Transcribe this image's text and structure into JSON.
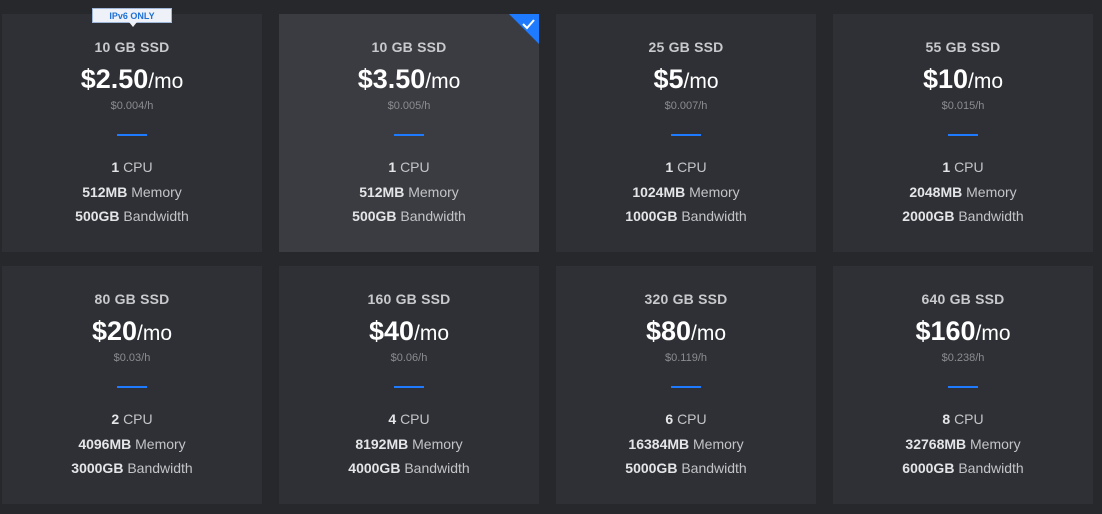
{
  "plans": [
    {
      "storage": "10 GB SSD",
      "price": "$2.50",
      "unit": "/mo",
      "hourly": "$0.004/h",
      "cpu": "1",
      "cpu_label": "CPU",
      "memory": "512MB",
      "memory_label": "Memory",
      "bandwidth": "500GB",
      "bandwidth_label": "Bandwidth",
      "badge": "IPv6 ONLY",
      "selected": false
    },
    {
      "storage": "10 GB SSD",
      "price": "$3.50",
      "unit": "/mo",
      "hourly": "$0.005/h",
      "cpu": "1",
      "cpu_label": "CPU",
      "memory": "512MB",
      "memory_label": "Memory",
      "bandwidth": "500GB",
      "bandwidth_label": "Bandwidth",
      "badge": "",
      "selected": true
    },
    {
      "storage": "25 GB SSD",
      "price": "$5",
      "unit": "/mo",
      "hourly": "$0.007/h",
      "cpu": "1",
      "cpu_label": "CPU",
      "memory": "1024MB",
      "memory_label": "Memory",
      "bandwidth": "1000GB",
      "bandwidth_label": "Bandwidth",
      "badge": "",
      "selected": false
    },
    {
      "storage": "55 GB SSD",
      "price": "$10",
      "unit": "/mo",
      "hourly": "$0.015/h",
      "cpu": "1",
      "cpu_label": "CPU",
      "memory": "2048MB",
      "memory_label": "Memory",
      "bandwidth": "2000GB",
      "bandwidth_label": "Bandwidth",
      "badge": "",
      "selected": false
    },
    {
      "storage": "80 GB SSD",
      "price": "$20",
      "unit": "/mo",
      "hourly": "$0.03/h",
      "cpu": "2",
      "cpu_label": "CPU",
      "memory": "4096MB",
      "memory_label": "Memory",
      "bandwidth": "3000GB",
      "bandwidth_label": "Bandwidth",
      "badge": "",
      "selected": false
    },
    {
      "storage": "160 GB SSD",
      "price": "$40",
      "unit": "/mo",
      "hourly": "$0.06/h",
      "cpu": "4",
      "cpu_label": "CPU",
      "memory": "8192MB",
      "memory_label": "Memory",
      "bandwidth": "4000GB",
      "bandwidth_label": "Bandwidth",
      "badge": "",
      "selected": false
    },
    {
      "storage": "320 GB SSD",
      "price": "$80",
      "unit": "/mo",
      "hourly": "$0.119/h",
      "cpu": "6",
      "cpu_label": "CPU",
      "memory": "16384MB",
      "memory_label": "Memory",
      "bandwidth": "5000GB",
      "bandwidth_label": "Bandwidth",
      "badge": "",
      "selected": false
    },
    {
      "storage": "640 GB SSD",
      "price": "$160",
      "unit": "/mo",
      "hourly": "$0.238/h",
      "cpu": "8",
      "cpu_label": "CPU",
      "memory": "32768MB",
      "memory_label": "Memory",
      "bandwidth": "6000GB",
      "bandwidth_label": "Bandwidth",
      "badge": "",
      "selected": false
    }
  ],
  "colors": {
    "accent": "#1e7bff",
    "card_bg": "#2f3035",
    "card_selected_bg": "#3b3c41",
    "page_bg": "#27282c"
  },
  "icons": {
    "selected": "check-icon"
  }
}
